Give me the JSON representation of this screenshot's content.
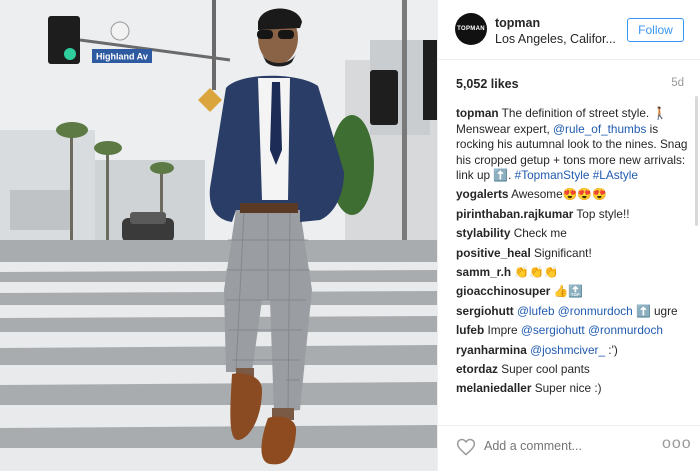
{
  "photo": {
    "street_sign": "Highland Av"
  },
  "header": {
    "avatar_text": "TOPMAN",
    "username": "topman",
    "location": "Los Angeles, Califor...",
    "follow_label": "Follow"
  },
  "stats": {
    "likes": "5,052 likes",
    "time": "5d"
  },
  "caption": {
    "user": "topman",
    "text1": " The definition of street style. ",
    "text2": "Menswear expert, ",
    "mention1": "@rule_of_thumbs",
    "text3": " is rocking his autumnal look to the nines. Snag his cropped getup + tons more new arrivals: link up ",
    "hashtag1": "#TopmanStyle",
    "hashtag2": "#LAstyle"
  },
  "comments": [
    {
      "user": "yogalerts",
      "text": " Awesome",
      "emoji": "😍😍😍"
    },
    {
      "user": "pirinthaban.rajkumar",
      "text": " Top style!!"
    },
    {
      "user": "stylability",
      "text": " Check me"
    },
    {
      "user": "positive_heal",
      "text": " Significant!"
    },
    {
      "user": "samm_r.h",
      "text": " ",
      "emoji": "👏👏👏"
    },
    {
      "user": "gioacchinosuper",
      "text": " ",
      "emoji": "👍🔝"
    },
    {
      "user": "sergiohutt",
      "mention1": "@lufeb",
      "mention2": "@ronmurdoch",
      "text": " ugre"
    },
    {
      "user": "lufeb",
      "text": " Impre ",
      "mention1": "@sergiohutt",
      "mention2": "@ronmurdoch"
    },
    {
      "user": "ryanharmina",
      "mention1": "@joshmciver_",
      "text": " :')"
    },
    {
      "user": "etordaz",
      "text": " Super cool pants"
    },
    {
      "user": "melaniedaller",
      "text": " Super nice :)"
    }
  ],
  "footer": {
    "add_comment_placeholder": "Add a comment...",
    "more_label": "ooo"
  },
  "colors": {
    "link": "#205bb0",
    "follow": "#3897f0",
    "muted": "#999999"
  }
}
